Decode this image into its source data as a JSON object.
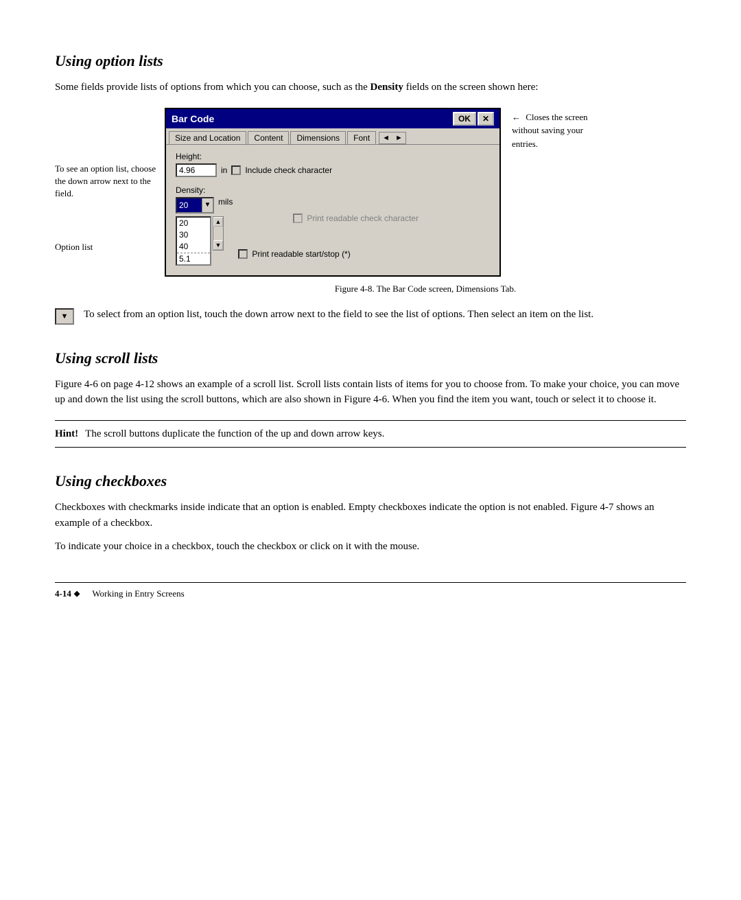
{
  "page": {
    "sections": [
      {
        "id": "using-option-lists",
        "title": "Using option lists",
        "paragraphs": [
          "Some fields provide lists of options from which you can choose, such as the Density fields on the screen shown here:"
        ]
      },
      {
        "id": "using-scroll-lists",
        "title": "Using scroll lists",
        "paragraphs": [
          "Figure 4-6 on page 4-12 shows an example of a scroll list. Scroll lists contain lists of items for you to choose from. To make your choice, you can move up and down the list using the scroll buttons, which are also shown in Figure 4-6. When you find the item you want, touch or select it to choose it."
        ]
      },
      {
        "id": "using-checkboxes",
        "title": "Using checkboxes",
        "paragraphs": [
          "Checkboxes with checkmarks inside indicate that an option is enabled. Empty checkboxes indicate the option is not enabled. Figure 4-7 shows an example of a checkbox.",
          "To indicate your choice in a checkbox, touch the checkbox or click on it with the mouse."
        ]
      }
    ],
    "dialog": {
      "title": "Bar Code",
      "ok_label": "OK",
      "close_label": "✕",
      "tabs": [
        "Size and Location",
        "Content",
        "Dimensions",
        "Font"
      ],
      "nav_prev": "◄",
      "nav_next": "►",
      "height_label": "Height:",
      "height_value": "4.96",
      "height_unit": "in",
      "include_check_label": "Include check character",
      "density_label": "Density:",
      "density_value": "20",
      "density_unit": "mils",
      "print_readable_check_label": "Print readable check character",
      "option_list_items": [
        "20",
        "30",
        "40",
        "5.1"
      ],
      "print_start_stop_label": "Print readable start/stop (*)"
    },
    "left_annotations": {
      "top": "To see an option list, choose the down arrow next to the field.",
      "bottom_label": "Option list",
      "arrow": "→"
    },
    "right_annotation": {
      "arrow_label": "←",
      "text": "Closes the screen without saving your entries."
    },
    "figure_caption": "Figure 4-8. The Bar Code screen, Dimensions Tab.",
    "icon_description": "To select from an option list, touch the down arrow next to the field to see the list of options. Then select an item on the list.",
    "hint": {
      "label": "Hint!",
      "text": "The scroll buttons duplicate the function of the up and down arrow keys."
    },
    "footer": {
      "page_number": "4-14",
      "diamond": "◆",
      "working_text": "Working in Entry Screens"
    }
  }
}
